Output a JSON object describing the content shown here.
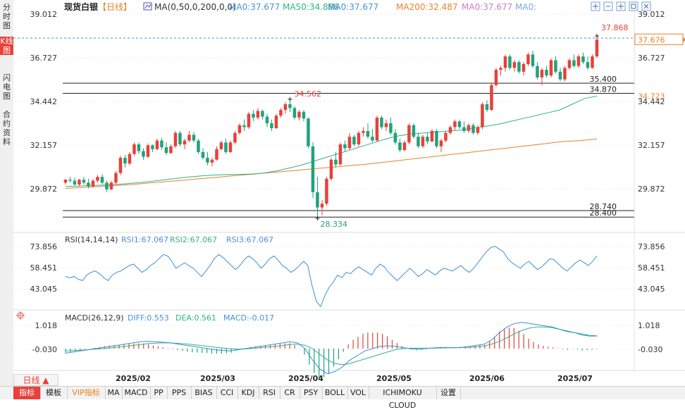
{
  "sidebar": {
    "tabs": [
      {
        "label": "分时图",
        "active": false
      },
      {
        "label": "K线图",
        "active": true
      },
      {
        "label": "闪电图",
        "active": false
      },
      {
        "label": "合约资料",
        "active": false
      }
    ]
  },
  "header": {
    "instrument": "现货白银",
    "period": "【日线】",
    "ma_config": "MA(0,50,0,200,0,0)",
    "ma_values": [
      {
        "text": "MA0:37.677",
        "color": "#4a90d9"
      },
      {
        "text": "MA50:34.886",
        "color": "#2eb38a"
      },
      {
        "text": "MA0:37.677",
        "color": "#4a90d9"
      },
      {
        "text": "MA200:32.487",
        "color": "#e8822e"
      },
      {
        "text": "MA0:37.677",
        "color": "#c77dc7"
      },
      {
        "text": "MA0:",
        "color": "#7aa7e0"
      }
    ],
    "toolbar_icons": [
      "move-cross-icon",
      "minus-icon",
      "plus-icon",
      "restore-icon",
      "maximize-icon"
    ]
  },
  "price_panel": {
    "y_ticks": [
      "39.012",
      "36.727",
      "34.442",
      "32.157",
      "29.872"
    ],
    "last_price": "37.676",
    "ma50_label": "34.723",
    "high_marker": "37.868",
    "low_marker": "28.334",
    "prev_high_marker": "34.562",
    "hlines": [
      {
        "label": "35.400"
      },
      {
        "label": "34.870"
      },
      {
        "label": "28.740"
      },
      {
        "label": "28.400"
      }
    ]
  },
  "rsi_panel": {
    "title": "RSI(14,14,14)",
    "values": [
      {
        "text": "RSI1:67.067",
        "color": "#4a90d9"
      },
      {
        "text": "RSI2:67.067",
        "color": "#2eb38a"
      },
      {
        "text": "RSI3:67.067",
        "color": "#4a90d9"
      }
    ],
    "y_ticks": [
      "73.856",
      "58.451",
      "43.045"
    ]
  },
  "macd_panel": {
    "title": "MACD(26,12,9)",
    "values": [
      {
        "text": "DIFF:0.553",
        "color": "#4a90d9"
      },
      {
        "text": "DEA:0.561",
        "color": "#2eb38a"
      },
      {
        "text": "MACD:-0.017",
        "color": "#4a90d9"
      }
    ],
    "y_ticks": [
      "1.018",
      "-0.030"
    ]
  },
  "x_axis": {
    "labels": [
      "2025/02",
      "2025/03",
      "2025/04",
      "2025/05",
      "2025/06",
      "2025/07"
    ]
  },
  "bottom": {
    "period_button": "日线 ▲",
    "tabs": [
      "指标",
      "模板",
      "VIP指标",
      "MA",
      "MACD",
      "PP",
      "PPS",
      "BIAS",
      "CCI",
      "KDJ",
      "RSI",
      "CR",
      "PSY",
      "BOLL",
      "VOL",
      "ICHIMOKU CLOUD",
      "设置"
    ]
  },
  "colors": {
    "up": "#e8403a",
    "down": "#1fa37a",
    "ma50": "#2eb38a",
    "ma200": "#e8822e",
    "rsi": "#3d8fd6",
    "diff": "#3d8fd6",
    "dea": "#2eb38a",
    "last_price": "#e8822e"
  },
  "chart_data": [
    {
      "type": "candlestick",
      "title": "现货白银【日线】",
      "x": [
        "2025/02",
        "2025/03",
        "2025/04",
        "2025/05",
        "2025/06",
        "2025/07"
      ],
      "ylim": [
        28.33,
        39.012
      ],
      "hlines": [
        35.4,
        34.87,
        28.74,
        28.4
      ],
      "annotations": {
        "high": 37.868,
        "low": 28.334,
        "swing_high": 34.562
      },
      "candles": [
        [
          30.2,
          30.4,
          30.1,
          30.35
        ],
        [
          30.35,
          30.5,
          30.2,
          30.3
        ],
        [
          30.3,
          30.45,
          30.0,
          30.1
        ],
        [
          30.1,
          30.4,
          30.0,
          30.35
        ],
        [
          30.35,
          30.5,
          30.1,
          30.2
        ],
        [
          30.2,
          30.4,
          29.9,
          30.0
        ],
        [
          30.0,
          30.4,
          29.95,
          30.3
        ],
        [
          30.3,
          30.6,
          30.2,
          30.5
        ],
        [
          30.5,
          30.65,
          30.1,
          30.2
        ],
        [
          30.2,
          30.3,
          29.7,
          29.85
        ],
        [
          29.85,
          30.3,
          29.8,
          30.2
        ],
        [
          30.2,
          30.8,
          30.1,
          30.7
        ],
        [
          30.7,
          31.6,
          30.6,
          31.5
        ],
        [
          31.5,
          31.65,
          31.0,
          31.2
        ],
        [
          31.2,
          31.8,
          31.1,
          31.7
        ],
        [
          31.7,
          32.3,
          31.6,
          32.2
        ],
        [
          32.2,
          32.3,
          31.7,
          31.85
        ],
        [
          31.85,
          32.0,
          31.4,
          31.55
        ],
        [
          31.55,
          32.25,
          31.5,
          32.15
        ],
        [
          32.15,
          32.2,
          31.8,
          31.95
        ],
        [
          31.95,
          32.5,
          31.9,
          32.4
        ],
        [
          32.4,
          32.55,
          31.9,
          32.05
        ],
        [
          32.05,
          32.3,
          31.65,
          31.75
        ],
        [
          31.75,
          32.2,
          31.7,
          32.1
        ],
        [
          32.1,
          32.9,
          32.0,
          32.8
        ],
        [
          32.8,
          32.9,
          32.1,
          32.2
        ],
        [
          32.2,
          32.5,
          31.95,
          32.4
        ],
        [
          32.4,
          32.9,
          32.3,
          32.7
        ],
        [
          32.7,
          32.85,
          32.3,
          32.4
        ],
        [
          32.4,
          32.5,
          31.7,
          31.8
        ],
        [
          31.8,
          32.0,
          31.4,
          31.5
        ],
        [
          31.5,
          31.8,
          31.1,
          31.25
        ],
        [
          31.25,
          31.5,
          31.05,
          31.4
        ],
        [
          31.4,
          32.1,
          31.35,
          31.95
        ],
        [
          31.95,
          32.4,
          31.9,
          32.3
        ],
        [
          32.3,
          32.5,
          31.7,
          31.8
        ],
        [
          31.8,
          32.4,
          31.75,
          32.3
        ],
        [
          32.3,
          32.9,
          32.2,
          32.8
        ],
        [
          32.8,
          33.3,
          32.7,
          33.2
        ],
        [
          33.2,
          33.5,
          32.9,
          33.1
        ],
        [
          33.1,
          33.9,
          33.0,
          33.8
        ],
        [
          33.8,
          34.0,
          33.4,
          33.6
        ],
        [
          33.6,
          34.1,
          33.5,
          33.95
        ],
        [
          33.95,
          34.0,
          33.5,
          33.65
        ],
        [
          33.65,
          33.8,
          33.1,
          33.3
        ],
        [
          33.3,
          33.5,
          32.9,
          33.05
        ],
        [
          33.05,
          33.8,
          33.0,
          33.7
        ],
        [
          33.7,
          34.1,
          33.6,
          34.0
        ],
        [
          34.0,
          34.4,
          33.8,
          34.3
        ],
        [
          34.3,
          34.562,
          33.9,
          34.1
        ],
        [
          34.1,
          34.2,
          33.5,
          33.6
        ],
        [
          33.6,
          34.0,
          33.45,
          33.9
        ],
        [
          33.9,
          34.0,
          33.4,
          33.55
        ],
        [
          33.55,
          33.6,
          32.0,
          32.1
        ],
        [
          32.1,
          32.3,
          29.4,
          29.7
        ],
        [
          29.7,
          30.5,
          28.334,
          28.9
        ],
        [
          28.9,
          29.3,
          28.5,
          29.1
        ],
        [
          29.1,
          30.5,
          29.0,
          30.4
        ],
        [
          30.4,
          31.5,
          30.3,
          31.4
        ],
        [
          31.4,
          31.8,
          31.0,
          31.15
        ],
        [
          31.15,
          32.3,
          31.1,
          32.2
        ],
        [
          32.2,
          32.4,
          31.8,
          32.0
        ],
        [
          32.0,
          32.8,
          31.9,
          32.6
        ],
        [
          32.6,
          32.7,
          32.1,
          32.2
        ],
        [
          32.2,
          32.9,
          32.1,
          32.8
        ],
        [
          32.8,
          33.1,
          32.6,
          32.9
        ],
        [
          32.9,
          33.3,
          32.5,
          32.6
        ],
        [
          32.6,
          33.0,
          32.3,
          32.4
        ],
        [
          32.4,
          33.7,
          32.35,
          33.6
        ],
        [
          33.6,
          33.7,
          33.0,
          33.1
        ],
        [
          33.1,
          33.5,
          32.9,
          33.3
        ],
        [
          33.3,
          33.6,
          32.7,
          32.8
        ],
        [
          32.8,
          33.0,
          32.2,
          32.3
        ],
        [
          32.3,
          32.5,
          31.8,
          31.9
        ],
        [
          31.9,
          32.4,
          31.85,
          32.3
        ],
        [
          32.3,
          33.3,
          32.2,
          33.2
        ],
        [
          33.2,
          33.3,
          32.5,
          32.6
        ],
        [
          32.6,
          32.8,
          32.0,
          32.1
        ],
        [
          32.1,
          32.7,
          32.0,
          32.6
        ],
        [
          32.6,
          32.8,
          32.2,
          32.35
        ],
        [
          32.35,
          33.0,
          32.3,
          32.9
        ],
        [
          32.9,
          33.0,
          32.0,
          32.1
        ],
        [
          32.1,
          32.5,
          31.8,
          32.4
        ],
        [
          32.4,
          32.9,
          32.3,
          32.8
        ],
        [
          32.8,
          33.2,
          32.7,
          33.1
        ],
        [
          33.1,
          33.5,
          32.95,
          33.4
        ],
        [
          33.4,
          33.5,
          33.0,
          33.1
        ],
        [
          33.1,
          33.4,
          32.8,
          32.9
        ],
        [
          32.9,
          33.3,
          32.8,
          33.2
        ],
        [
          33.2,
          33.3,
          32.7,
          32.8
        ],
        [
          32.8,
          33.2,
          32.7,
          33.1
        ],
        [
          33.1,
          34.4,
          33.0,
          34.3
        ],
        [
          34.3,
          34.5,
          33.9,
          34.0
        ],
        [
          34.0,
          35.4,
          33.95,
          35.3
        ],
        [
          35.3,
          36.2,
          35.2,
          36.1
        ],
        [
          36.1,
          36.3,
          35.8,
          36.2
        ],
        [
          36.2,
          36.9,
          36.0,
          36.8
        ],
        [
          36.8,
          36.9,
          36.1,
          36.2
        ],
        [
          36.2,
          36.6,
          36.0,
          36.5
        ],
        [
          36.5,
          36.6,
          35.9,
          36.0
        ],
        [
          36.0,
          36.5,
          35.8,
          36.4
        ],
        [
          36.4,
          37.0,
          36.3,
          36.9
        ],
        [
          36.9,
          37.1,
          36.2,
          36.3
        ],
        [
          36.3,
          36.5,
          35.6,
          35.7
        ],
        [
          35.7,
          36.2,
          35.3,
          36.1
        ],
        [
          36.1,
          36.3,
          35.7,
          35.8
        ],
        [
          35.8,
          36.7,
          35.7,
          36.6
        ],
        [
          36.6,
          36.8,
          35.9,
          36.0
        ],
        [
          36.0,
          36.2,
          35.5,
          35.6
        ],
        [
          35.6,
          36.3,
          35.5,
          36.2
        ],
        [
          36.2,
          36.7,
          36.1,
          36.6
        ],
        [
          36.6,
          36.9,
          36.2,
          36.3
        ],
        [
          36.3,
          36.9,
          36.2,
          36.8
        ],
        [
          36.8,
          37.0,
          36.4,
          36.5
        ],
        [
          36.5,
          36.8,
          36.1,
          36.2
        ],
        [
          36.2,
          36.9,
          36.15,
          36.8
        ],
        [
          36.8,
          37.868,
          36.7,
          37.676
        ]
      ],
      "ma50": [
        30.0,
        30.02,
        30.05,
        30.07,
        30.1,
        30.15,
        30.2,
        30.27,
        30.35,
        30.42,
        30.5,
        30.55,
        30.6,
        30.62,
        30.63,
        30.65,
        30.7,
        30.8,
        30.95,
        31.1,
        31.3,
        31.5,
        31.7,
        31.9,
        32.1,
        32.3,
        32.5,
        32.65,
        32.75,
        32.8,
        32.85,
        32.9,
        32.95,
        33.05,
        33.15,
        33.25,
        33.4,
        33.55,
        33.7,
        33.85,
        34.0,
        34.3,
        34.6,
        34.723
      ],
      "ma200": [
        29.9,
        29.95,
        30.0,
        30.05,
        30.1,
        30.18,
        30.25,
        30.32,
        30.4,
        30.47,
        30.55,
        30.62,
        30.7,
        30.77,
        30.85,
        30.93,
        31.0,
        31.08,
        31.15,
        31.25,
        31.35,
        31.45,
        31.55,
        31.65,
        31.75,
        31.85,
        31.95,
        32.05,
        32.15,
        32.25,
        32.35,
        32.4,
        32.487
      ]
    },
    {
      "type": "line",
      "title": "RSI(14,14,14)",
      "ylim": [
        38,
        76
      ],
      "series": [
        {
          "name": "RSI1",
          "values": [
            52,
            51,
            52,
            50,
            49,
            53,
            55,
            56,
            54,
            51,
            49,
            53,
            55,
            56,
            58,
            60,
            61,
            58,
            55,
            57,
            60,
            62,
            65,
            68,
            67,
            63,
            58,
            60,
            62,
            60,
            58,
            55,
            52,
            56,
            60,
            65,
            68,
            66,
            63,
            60,
            57,
            60,
            64,
            67,
            65,
            62,
            58,
            61,
            65,
            67,
            64,
            60,
            58,
            55,
            57,
            60,
            63,
            60,
            45,
            34,
            30,
            38,
            44,
            48,
            53,
            51,
            55,
            54,
            57,
            59,
            57,
            55,
            53,
            58,
            61,
            59,
            55,
            52,
            49,
            52,
            55,
            58,
            55,
            52,
            54,
            57,
            55,
            53,
            56,
            58,
            57,
            56,
            58,
            60,
            57,
            55,
            58,
            62,
            66,
            70,
            73,
            74,
            72,
            70,
            65,
            62,
            60,
            58,
            61,
            63,
            60,
            57,
            59,
            62,
            65,
            64,
            61,
            58,
            56,
            59,
            62,
            64,
            62,
            60,
            63,
            67
          ]
        }
      ]
    },
    {
      "type": "line",
      "title": "MACD(26,12,9)",
      "ylim": [
        -1.5,
        1.4
      ],
      "series": [
        {
          "name": "DIFF",
          "values": [
            -0.2,
            -0.15,
            -0.1,
            -0.05,
            0.0,
            0.05,
            0.1,
            0.15,
            0.2,
            0.25,
            0.3,
            0.32,
            0.3,
            0.28,
            0.25,
            0.2,
            0.15,
            0.1,
            0.05,
            0.0,
            -0.05,
            -0.08,
            -0.1,
            -0.05,
            0.0,
            0.05,
            0.1,
            0.15,
            0.2,
            0.25,
            0.3,
            0.25,
            0.0,
            -0.5,
            -0.9,
            -1.1,
            -1.0,
            -0.8,
            -0.5,
            -0.3,
            -0.1,
            0.0,
            0.1,
            0.12,
            0.1,
            0.05,
            0.0,
            -0.02,
            0.0,
            0.03,
            0.05,
            0.05,
            0.04,
            0.06,
            0.1,
            0.15,
            0.2,
            0.4,
            0.7,
            0.95,
            1.1,
            1.15,
            1.1,
            1.05,
            1.0,
            0.95,
            0.85,
            0.75,
            0.7,
            0.6,
            0.55,
            0.553
          ]
        },
        {
          "name": "DEA",
          "values": [
            -0.1,
            -0.09,
            -0.07,
            -0.05,
            -0.02,
            0.0,
            0.03,
            0.07,
            0.1,
            0.14,
            0.18,
            0.22,
            0.24,
            0.25,
            0.25,
            0.23,
            0.21,
            0.18,
            0.14,
            0.1,
            0.06,
            0.03,
            0.0,
            -0.02,
            -0.01,
            0.01,
            0.04,
            0.07,
            0.1,
            0.14,
            0.18,
            0.2,
            0.15,
            0.0,
            -0.25,
            -0.5,
            -0.65,
            -0.7,
            -0.65,
            -0.55,
            -0.45,
            -0.35,
            -0.25,
            -0.15,
            -0.05,
            0.0,
            0.02,
            0.02,
            0.02,
            0.02,
            0.03,
            0.04,
            0.04,
            0.05,
            0.06,
            0.08,
            0.12,
            0.2,
            0.32,
            0.48,
            0.65,
            0.8,
            0.9,
            0.95,
            0.95,
            0.92,
            0.85,
            0.78,
            0.7,
            0.64,
            0.58,
            0.561
          ]
        }
      ]
    }
  ]
}
